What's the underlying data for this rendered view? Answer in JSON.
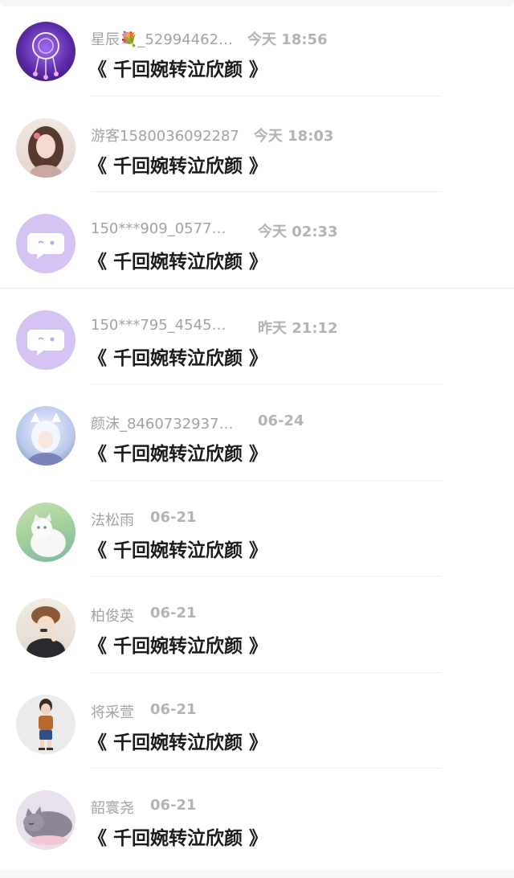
{
  "colors": {
    "bubble_avatar_bg": "#d5c4f3",
    "name_text": "#a3a3a3",
    "time_text": "#b3b3b3",
    "message_text": "#1a1a1a"
  },
  "messages": [
    {
      "name": "星辰💐_52994462…",
      "time": "今天 18:56",
      "text": "《 千回婉转泣欣颜 》",
      "avatar": "dreamcatcher-avatar"
    },
    {
      "name": "游客1580036092287",
      "time": "今天 18:03",
      "text": "《 千回婉转泣欣颜 》",
      "avatar": "girl-portrait-avatar"
    },
    {
      "name": "150***909_0577…",
      "time": "今天 02:33",
      "text": "《 千回婉转泣欣颜 》",
      "avatar": "chat-bubble-avatar"
    },
    {
      "name": "150***795_4545…",
      "time": "昨天 21:12",
      "text": "《 千回婉转泣欣颜 》",
      "avatar": "chat-bubble-avatar"
    },
    {
      "name": "颜沫_8460732937…",
      "time": "06-24",
      "text": "《 千回婉转泣欣颜 》",
      "avatar": "anime-avatar"
    },
    {
      "name": "法松雨",
      "time": "06-21",
      "text": "《 千回婉转泣欣颜 》",
      "avatar": "white-cat-avatar"
    },
    {
      "name": "柏俊英",
      "time": "06-21",
      "text": "《 千回婉转泣欣颜 》",
      "avatar": "person-hat-avatar"
    },
    {
      "name": "将采萱",
      "time": "06-21",
      "text": "《 千回婉转泣欣颜 》",
      "avatar": "3d-figure-avatar"
    },
    {
      "name": "韶寰尧",
      "time": "06-21",
      "text": "《 千回婉转泣欣颜 》",
      "avatar": "sleeping-cat-avatar"
    }
  ]
}
